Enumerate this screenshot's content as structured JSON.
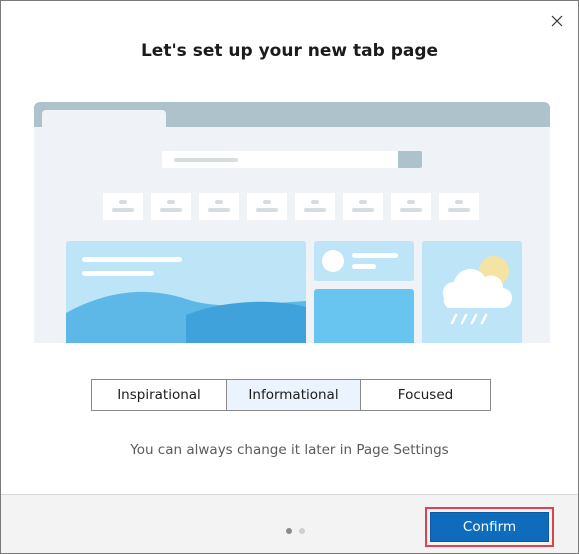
{
  "dialog": {
    "title": "Let's set up your new tab page",
    "close_icon": "close-icon"
  },
  "layout_options": [
    {
      "label": "Inspirational",
      "selected": false
    },
    {
      "label": "Informational",
      "selected": true
    },
    {
      "label": "Focused",
      "selected": false
    }
  ],
  "hint": "You can always change it later in Page Settings",
  "pagination": {
    "current": 1,
    "total": 2
  },
  "footer": {
    "confirm_label": "Confirm"
  },
  "colors": {
    "accent": "#0f6cbd",
    "highlight_outline": "#e0414a",
    "preview_bar": "#aec2cc",
    "preview_card": "#bee4f7",
    "preview_card_strong": "#68c5f0"
  }
}
